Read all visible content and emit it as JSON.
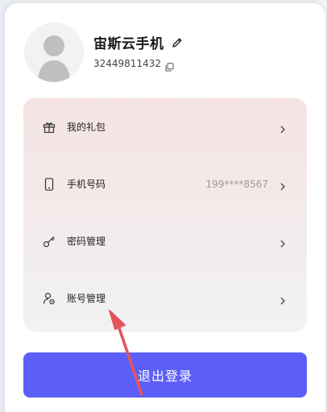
{
  "profile": {
    "name": "宙斯云手机",
    "uid": "32449811432",
    "avatar_icon": "default-user-avatar",
    "edit_icon": "pencil-icon",
    "copy_icon": "copy-icon"
  },
  "menu": {
    "items": [
      {
        "label": "我的礼包",
        "value": "",
        "icon": "gift-icon"
      },
      {
        "label": "手机号码",
        "value": "199****8567",
        "icon": "phone-icon"
      },
      {
        "label": "密码管理",
        "value": "",
        "icon": "key-icon"
      },
      {
        "label": "账号管理",
        "value": "",
        "icon": "account-settings-icon"
      }
    ]
  },
  "logout_label": "退出登录",
  "colors": {
    "primary": "#5b5ff8",
    "annotation_arrow": "#e5545a",
    "card_top": "#f5e3e3"
  }
}
